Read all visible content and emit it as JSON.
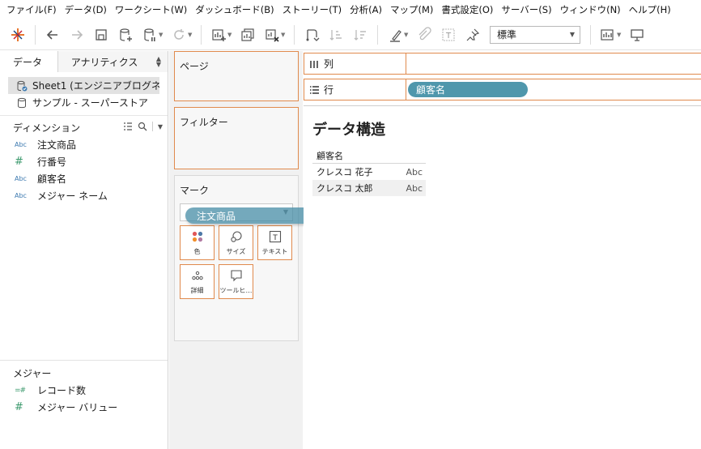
{
  "menu": [
    "ファイル(F)",
    "データ(D)",
    "ワークシート(W)",
    "ダッシュボード(B)",
    "ストーリー(T)",
    "分析(A)",
    "マップ(M)",
    "書式設定(O)",
    "サーバー(S)",
    "ウィンドウ(N)",
    "ヘルプ(H)"
  ],
  "toolbar": {
    "fit_select": "標準"
  },
  "left_pane": {
    "tab_data": "データ",
    "tab_analytics": "アナリティクス",
    "datasources": [
      "Sheet1 (エンジニアブログネ…",
      "サンプル - スーパーストア"
    ],
    "dimensions_title": "ディメンション",
    "dimensions": [
      {
        "type": "Abc",
        "name": "注文商品"
      },
      {
        "type": "#",
        "name": "行番号"
      },
      {
        "type": "Abc",
        "name": "顧客名"
      },
      {
        "type": "Abc",
        "name": "メジャー ネーム"
      }
    ],
    "measures_title": "メジャー",
    "measures": [
      {
        "type": "=#",
        "name": "レコード数"
      },
      {
        "type": "#",
        "name": "メジャー バリュー"
      }
    ]
  },
  "cards": {
    "pages": "ページ",
    "filters": "フィルター",
    "marks": "マーク",
    "mark_buttons": [
      "色",
      "サイズ",
      "テキスト",
      "詳細",
      "ツールヒ…"
    ]
  },
  "drag_pill": "注文商品",
  "shelves": {
    "columns_label": "列",
    "rows_label": "行",
    "rows_pill": "顧客名"
  },
  "view": {
    "title": "データ構造",
    "column_header": "顧客名",
    "rows": [
      {
        "name": "クレスコ 花子",
        "value": "Abc"
      },
      {
        "name": "クレスコ 太郎",
        "value": "Abc"
      }
    ]
  },
  "colors": {
    "accent_orange": "#e08a4d",
    "pill_blue": "#4f97ac"
  }
}
